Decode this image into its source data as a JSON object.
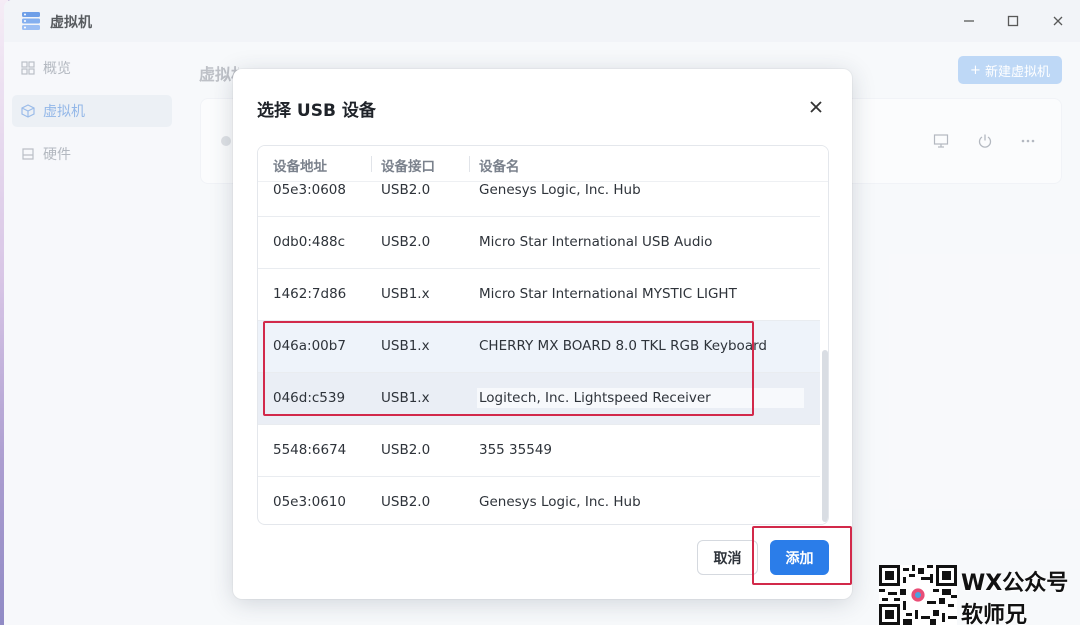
{
  "window": {
    "title": "虚拟机",
    "controls": {
      "minimize_icon": "minimize-icon",
      "maximize_icon": "maximize-icon",
      "close_icon": "close-icon"
    }
  },
  "sidebar": {
    "items": [
      {
        "label": "概览",
        "icon": "grid-icon",
        "active": false
      },
      {
        "label": "虚拟机",
        "icon": "cube-icon",
        "active": true
      },
      {
        "label": "硬件",
        "icon": "drive-icon",
        "active": false
      }
    ]
  },
  "main": {
    "title": "虚拟机",
    "new_vm_button": "新建虚拟机"
  },
  "dialog": {
    "title": "选择 USB 设备",
    "columns": [
      "设备地址",
      "设备接口",
      "设备名"
    ],
    "rows": [
      {
        "address": "05e3:0608",
        "interface": "USB2.0",
        "name": "Genesys Logic, Inc. Hub"
      },
      {
        "address": "0db0:488c",
        "interface": "USB2.0",
        "name": "Micro Star International USB Audio"
      },
      {
        "address": "1462:7d86",
        "interface": "USB1.x",
        "name": "Micro Star International MYSTIC LIGHT"
      },
      {
        "address": "046a:00b7",
        "interface": "USB1.x",
        "name": "CHERRY MX BOARD 8.0 TKL RGB Keyboard"
      },
      {
        "address": "046d:c539",
        "interface": "USB1.x",
        "name": "Logitech, Inc. Lightspeed Receiver"
      },
      {
        "address": "5548:6674",
        "interface": "USB2.0",
        "name": "355 35549"
      },
      {
        "address": "05e3:0610",
        "interface": "USB2.0",
        "name": "Genesys Logic, Inc. Hub"
      }
    ],
    "cancel_button": "取消",
    "add_button": "添加"
  },
  "watermark": {
    "line1": "WX公众号",
    "line2": "软师兄"
  },
  "colors": {
    "accent": "#2b7de9",
    "annotation": "#d2294a"
  }
}
